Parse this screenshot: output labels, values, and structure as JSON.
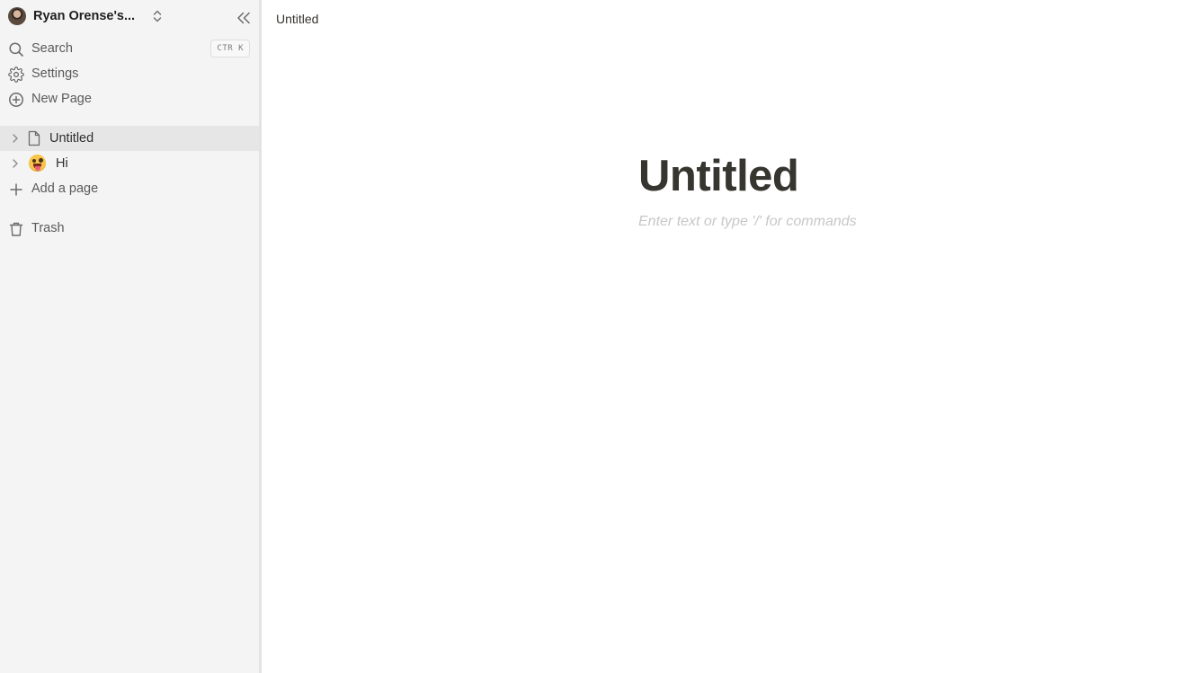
{
  "sidebar": {
    "workspace": {
      "name": "Ryan Orense's...",
      "avatar_icon": "user-avatar",
      "switch_icon": "chevron-up-down-icon",
      "collapse_icon": "double-chevron-left-icon"
    },
    "nav": {
      "search": {
        "label": "Search",
        "icon": "search-icon",
        "shortcut": "CTR K"
      },
      "settings": {
        "label": "Settings",
        "icon": "gear-icon"
      },
      "new_page": {
        "label": "New Page",
        "icon": "plus-circle-icon"
      }
    },
    "pages": [
      {
        "label": "Untitled",
        "icon": "document-icon",
        "selected": true
      },
      {
        "label": "Hi",
        "icon": "crazy-face-emoji"
      }
    ],
    "add_page": {
      "label": "Add a page",
      "icon": "plus-icon"
    },
    "trash": {
      "label": "Trash",
      "icon": "trash-icon"
    }
  },
  "main": {
    "breadcrumb": "Untitled",
    "title": "Untitled",
    "editor_placeholder": "Enter text or type '/' for commands"
  },
  "colors": {
    "sidebar_bg": "#f4f4f4",
    "selected_row": "#e6e6e6",
    "title_text": "#37352f",
    "placeholder_text": "#c7c7c7"
  }
}
